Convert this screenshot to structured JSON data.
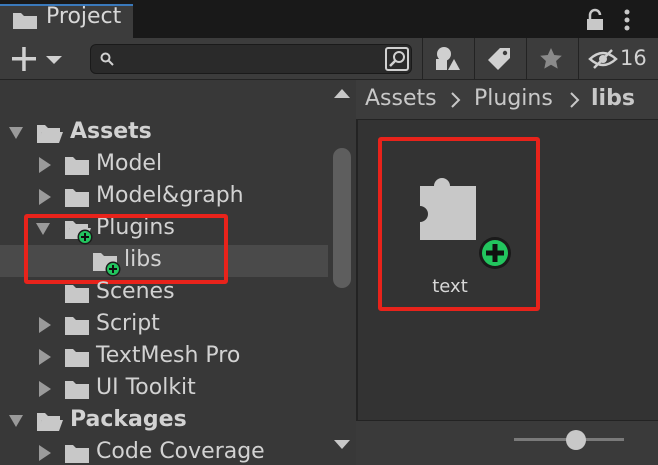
{
  "tab": {
    "title": "Project",
    "hidden_count": "16"
  },
  "search": {
    "placeholder": ""
  },
  "tree": {
    "assets": "Assets",
    "model": "Model",
    "model_graph": "Model&graph",
    "plugins": "Plugins",
    "libs": "libs",
    "scenes": "Scenes",
    "script": "Script",
    "textmesh": "TextMesh Pro",
    "ui_toolkit": "UI Toolkit",
    "packages": "Packages",
    "code_coverage": "Code Coverage"
  },
  "breadcrumb": {
    "assets": "Assets",
    "plugins": "Plugins",
    "libs": "libs"
  },
  "asset": {
    "label": "text",
    "icon": "plugin-puzzle-icon"
  },
  "colors": {
    "accent": "#3a79bb",
    "highlight": "#e8231b",
    "add_badge": "#22c55e"
  }
}
